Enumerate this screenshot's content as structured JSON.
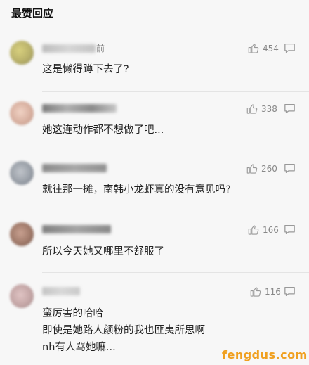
{
  "section": {
    "title": "最赞回应"
  },
  "comments": [
    {
      "time_suffix": "前",
      "likes": "454",
      "lines": [
        "这是懒得蹲下去了?"
      ],
      "avatar_color": "#c9c27a"
    },
    {
      "time_suffix": "",
      "likes": "338",
      "lines": [
        "她这连动作都不想做了吧..."
      ],
      "avatar_color": "#d8b7a8"
    },
    {
      "time_suffix": "",
      "likes": "260",
      "lines": [
        "就往那一摊，南韩小龙虾真的没有意见吗?"
      ],
      "avatar_color": "#9aa0a8"
    },
    {
      "time_suffix": "",
      "likes": "166",
      "lines": [
        "所以今天她又哪里不舒服了"
      ],
      "avatar_color": "#a07a6a"
    },
    {
      "time_suffix": "",
      "likes": "116",
      "lines": [
        "蛮厉害的哈哈",
        "即使是她路人颜粉的我也匪夷所思啊",
        "nh有人骂她嘛..."
      ],
      "avatar_color": "#c4a6a6"
    }
  ],
  "watermark": "fengdus.com"
}
